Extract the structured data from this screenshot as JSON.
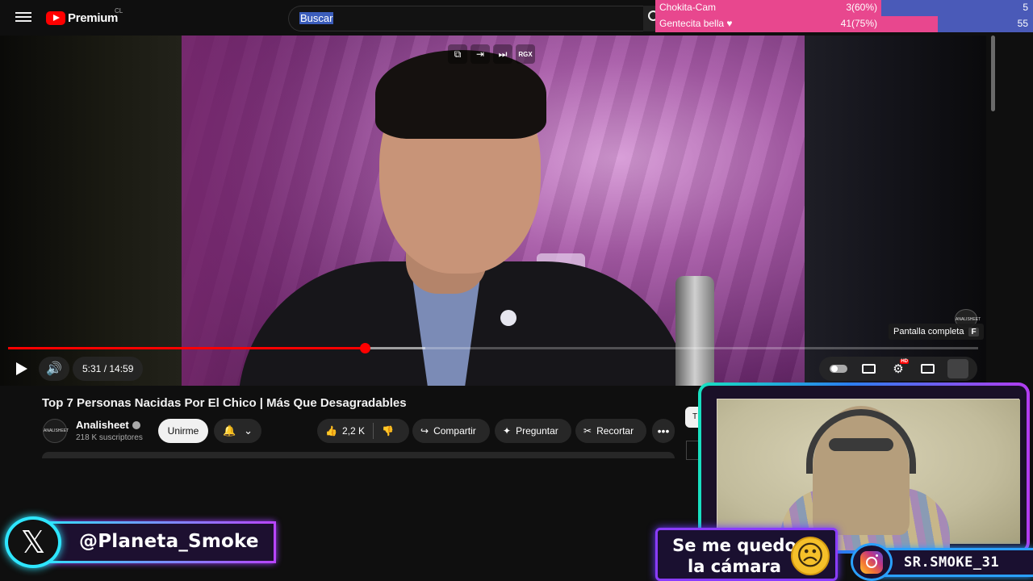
{
  "header": {
    "logo_text": "Premium",
    "logo_country": "CL",
    "search_value": "Buscar"
  },
  "poll": {
    "rows": [
      {
        "name": "Chokita-Cam",
        "pct": "3(60%)",
        "count": "5",
        "fraction": 0.6
      },
      {
        "name": "Gentecita bella ♥",
        "pct": "41(75%)",
        "count": "55",
        "fraction": 0.75
      }
    ],
    "colors": {
      "left": "#e8478e",
      "right": "#4a5ab8"
    }
  },
  "player": {
    "time_label": "5:31 / 14:59",
    "progress_fraction": 0.368,
    "buffer_fraction": 0.43,
    "overlay_icons": [
      "pip-icon",
      "exit-icon",
      "next-icon",
      "RGX"
    ],
    "fullscreen_tip": "Pantalla completa",
    "fullscreen_key": "F",
    "watermark": "ANALISHEET",
    "hd_badge": "HD"
  },
  "video": {
    "title": "Top 7 Personas Nacidas Por El Chico | Más Que Desagradables",
    "channel": "Analisheet",
    "subscribers": "218 K suscriptores",
    "join_label": "Unirme",
    "likes": "2,2 K",
    "share_label": "Compartir",
    "ask_label": "Preguntar",
    "clip_label": "Recortar",
    "side_chip": "T"
  },
  "overlays": {
    "twitter_handle": "@Planeta_Smoke",
    "caption": "Se me quedo la cámara",
    "instagram_handle": "SR.SMOKE_31"
  }
}
